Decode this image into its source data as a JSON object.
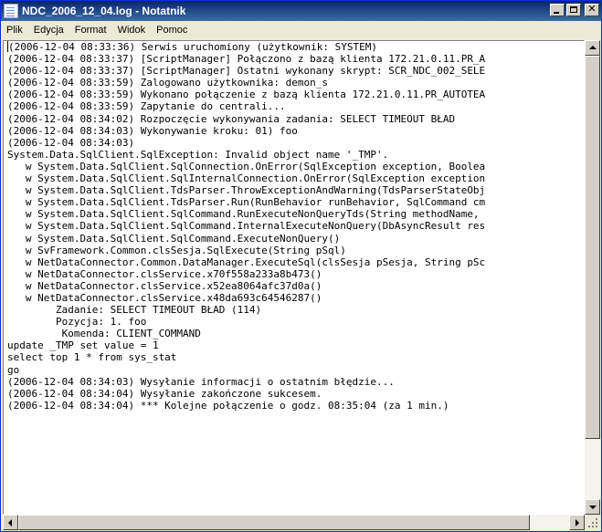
{
  "window": {
    "title": "NDC_2006_12_04.log - Notatnik"
  },
  "menu": [
    "Plik",
    "Edycja",
    "Format",
    "Widok",
    "Pomoc"
  ],
  "document": {
    "lines": [
      "(2006-12-04 08:33:36) Serwis uruchomiony (użytkownik: SYSTEM)",
      "(2006-12-04 08:33:37) [ScriptManager] Połączono z bazą klienta 172.21.0.11.PR_A",
      "(2006-12-04 08:33:37) [ScriptManager] Ostatni wykonany skrypt: SCR_NDC_002_SELE",
      "(2006-12-04 08:33:59) Zalogowano użytkownika: demon_s",
      "(2006-12-04 08:33:59) Wykonano połączenie z bazą klienta 172.21.0.11.PR_AUTOTEA",
      "(2006-12-04 08:33:59) Zapytanie do centrali...",
      "(2006-12-04 08:34:02) Rozpoczęcie wykonywania zadania: SELECT TIMEOUT BŁAD",
      "(2006-12-04 08:34:03) Wykonywanie kroku: 01) foo",
      "(2006-12-04 08:34:03)",
      "System.Data.SqlClient.SqlException: Invalid object name '_TMP'.",
      "   w System.Data.SqlClient.SqlConnection.OnError(SqlException exception, Boolea",
      "   w System.Data.SqlClient.SqlInternalConnection.OnError(SqlException exception",
      "   w System.Data.SqlClient.TdsParser.ThrowExceptionAndWarning(TdsParserStateObj",
      "   w System.Data.SqlClient.TdsParser.Run(RunBehavior runBehavior, SqlCommand cm",
      "   w System.Data.SqlClient.SqlCommand.RunExecuteNonQueryTds(String methodName, ",
      "   w System.Data.SqlClient.SqlCommand.InternalExecuteNonQuery(DbAsyncResult res",
      "   w System.Data.SqlClient.SqlCommand.ExecuteNonQuery()",
      "   w SvFramework.Common.clsSesja.SqlExecute(String pSql)",
      "   w NetDataConnector.Common.DataManager.ExecuteSql(clsSesja pSesja, String pSc",
      "   w NetDataConnector.clsService.x70f558a233a8b473()",
      "   w NetDataConnector.clsService.x52ea8064afc37d0a()",
      "   w NetDataConnector.clsService.x48da693c64546287()",
      "        Zadanie: SELECT TIMEOUT BŁAD (114)",
      "        Pozycja: 1. foo",
      "         Komenda: CLIENT_COMMAND",
      "update _TMP set value = 1",
      "select top 1 * from sys_stat",
      "go",
      "(2006-12-04 08:34:03) Wysyłanie informacji o ostatnim błędzie...",
      "(2006-12-04 08:34:04) Wysyłanie zakończone sukcesem.",
      "(2006-12-04 08:34:04) *** Kolejne połączenie o godz. 08:35:04 (za 1 min.)"
    ]
  }
}
